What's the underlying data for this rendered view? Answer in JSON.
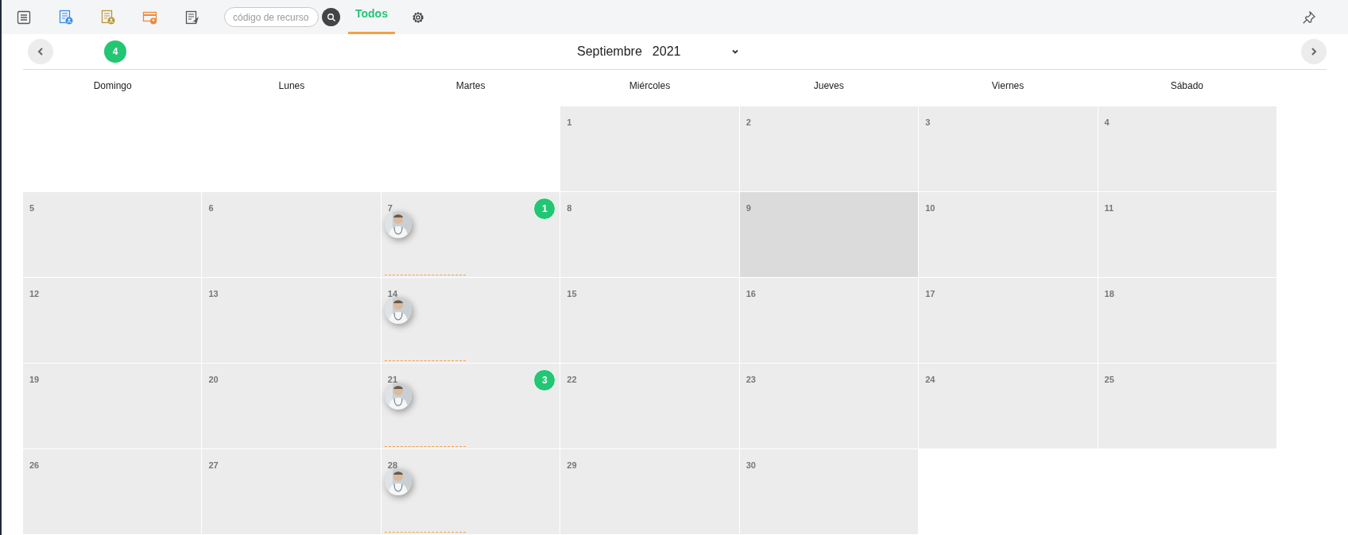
{
  "toolbar": {
    "search": {
      "placeholder": "código de recurso"
    },
    "tabs": [
      {
        "label": "Todos",
        "selected": true
      }
    ]
  },
  "header": {
    "badge": "4",
    "month": "Septiembre",
    "year": "2021"
  },
  "weekdays": [
    "Domingo",
    "Lunes",
    "Martes",
    "Miércoles",
    "Jueves",
    "Viernes",
    "Sábado"
  ],
  "weeks": [
    [
      {
        "kind": "blank"
      },
      {
        "kind": "blank"
      },
      {
        "kind": "blank"
      },
      {
        "kind": "day",
        "day": "1",
        "today": false,
        "appointment": false
      },
      {
        "kind": "day",
        "day": "2",
        "today": false,
        "appointment": false
      },
      {
        "kind": "day",
        "day": "3",
        "today": false,
        "appointment": false
      },
      {
        "kind": "day",
        "day": "4",
        "today": false,
        "appointment": false
      }
    ],
    [
      {
        "kind": "day",
        "day": "5",
        "today": false,
        "appointment": false
      },
      {
        "kind": "day",
        "day": "6",
        "today": false,
        "appointment": false
      },
      {
        "kind": "day",
        "day": "7",
        "today": false,
        "appointment": true,
        "badge": "1"
      },
      {
        "kind": "day",
        "day": "8",
        "today": false,
        "appointment": false
      },
      {
        "kind": "day",
        "day": "9",
        "today": true,
        "appointment": false
      },
      {
        "kind": "day",
        "day": "10",
        "today": false,
        "appointment": false
      },
      {
        "kind": "day",
        "day": "11",
        "today": false,
        "appointment": false
      }
    ],
    [
      {
        "kind": "day",
        "day": "12",
        "today": false,
        "appointment": false
      },
      {
        "kind": "day",
        "day": "13",
        "today": false,
        "appointment": false
      },
      {
        "kind": "day",
        "day": "14",
        "today": false,
        "appointment": true
      },
      {
        "kind": "day",
        "day": "15",
        "today": false,
        "appointment": false
      },
      {
        "kind": "day",
        "day": "16",
        "today": false,
        "appointment": false
      },
      {
        "kind": "day",
        "day": "17",
        "today": false,
        "appointment": false
      },
      {
        "kind": "day",
        "day": "18",
        "today": false,
        "appointment": false
      }
    ],
    [
      {
        "kind": "day",
        "day": "19",
        "today": false,
        "appointment": false
      },
      {
        "kind": "day",
        "day": "20",
        "today": false,
        "appointment": false
      },
      {
        "kind": "day",
        "day": "21",
        "today": false,
        "appointment": true,
        "badge": "3"
      },
      {
        "kind": "day",
        "day": "22",
        "today": false,
        "appointment": false
      },
      {
        "kind": "day",
        "day": "23",
        "today": false,
        "appointment": false
      },
      {
        "kind": "day",
        "day": "24",
        "today": false,
        "appointment": false
      },
      {
        "kind": "day",
        "day": "25",
        "today": false,
        "appointment": false
      }
    ],
    [
      {
        "kind": "day",
        "day": "26",
        "today": false,
        "appointment": false
      },
      {
        "kind": "day",
        "day": "27",
        "today": false,
        "appointment": false
      },
      {
        "kind": "day",
        "day": "28",
        "today": false,
        "appointment": true
      },
      {
        "kind": "day",
        "day": "29",
        "today": false,
        "appointment": false
      },
      {
        "kind": "day",
        "day": "30",
        "today": false,
        "appointment": false
      },
      {
        "kind": "blank"
      },
      {
        "kind": "blank"
      }
    ]
  ]
}
